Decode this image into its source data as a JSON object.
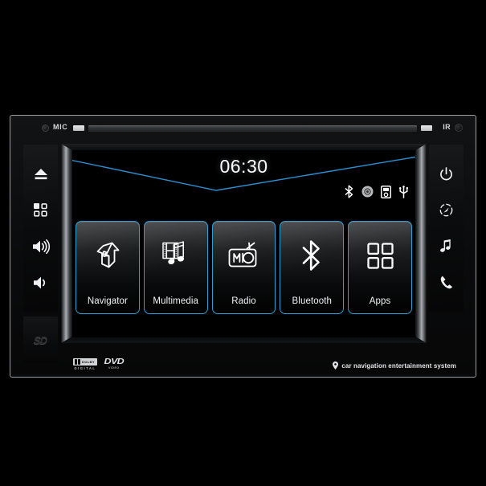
{
  "device": {
    "type": "car-stereo-head-unit",
    "tagline": "car navigation entertainment system",
    "mic_label": "MIC",
    "ir_label": "IR",
    "sd_label": "SD",
    "logos": {
      "dolby_word": "DOLBY",
      "dolby_sub": "DIGITAL",
      "dvd_word": "DVD",
      "dvd_sub": "VIDEO"
    }
  },
  "screen": {
    "clock": "06:30",
    "accent_color": "#2d9fd6",
    "background_color": "#000000",
    "status_icons": [
      {
        "name": "bluetooth-icon",
        "label": "Bluetooth"
      },
      {
        "name": "disc-icon",
        "label": "Disc"
      },
      {
        "name": "ipod-icon",
        "label": "iPod"
      },
      {
        "name": "usb-icon",
        "label": "USB"
      }
    ],
    "tiles": [
      {
        "label": "Navigator",
        "icon": "signpost-arrow-icon"
      },
      {
        "label": "Multimedia",
        "icon": "film-music-icon"
      },
      {
        "label": "Radio",
        "icon": "radio-icon"
      },
      {
        "label": "Bluetooth",
        "icon": "bluetooth-icon"
      },
      {
        "label": "Apps",
        "icon": "grid-apps-icon"
      }
    ]
  },
  "left_buttons": [
    {
      "name": "eject-button",
      "icon": "eject-icon",
      "label": "Eject"
    },
    {
      "name": "apps-button",
      "icon": "grid-apps-icon",
      "label": "Apps"
    },
    {
      "name": "volume-up-button",
      "icon": "volume-up-icon",
      "label": "Volume Up"
    },
    {
      "name": "volume-down-button",
      "icon": "volume-down-icon",
      "label": "Volume Down"
    }
  ],
  "right_buttons": [
    {
      "name": "power-button",
      "icon": "power-icon",
      "label": "Power"
    },
    {
      "name": "navigation-button",
      "icon": "compass-icon",
      "label": "Navigation"
    },
    {
      "name": "music-button",
      "icon": "music-note-icon",
      "label": "Music"
    },
    {
      "name": "phone-button",
      "icon": "phone-icon",
      "label": "Phone"
    }
  ]
}
